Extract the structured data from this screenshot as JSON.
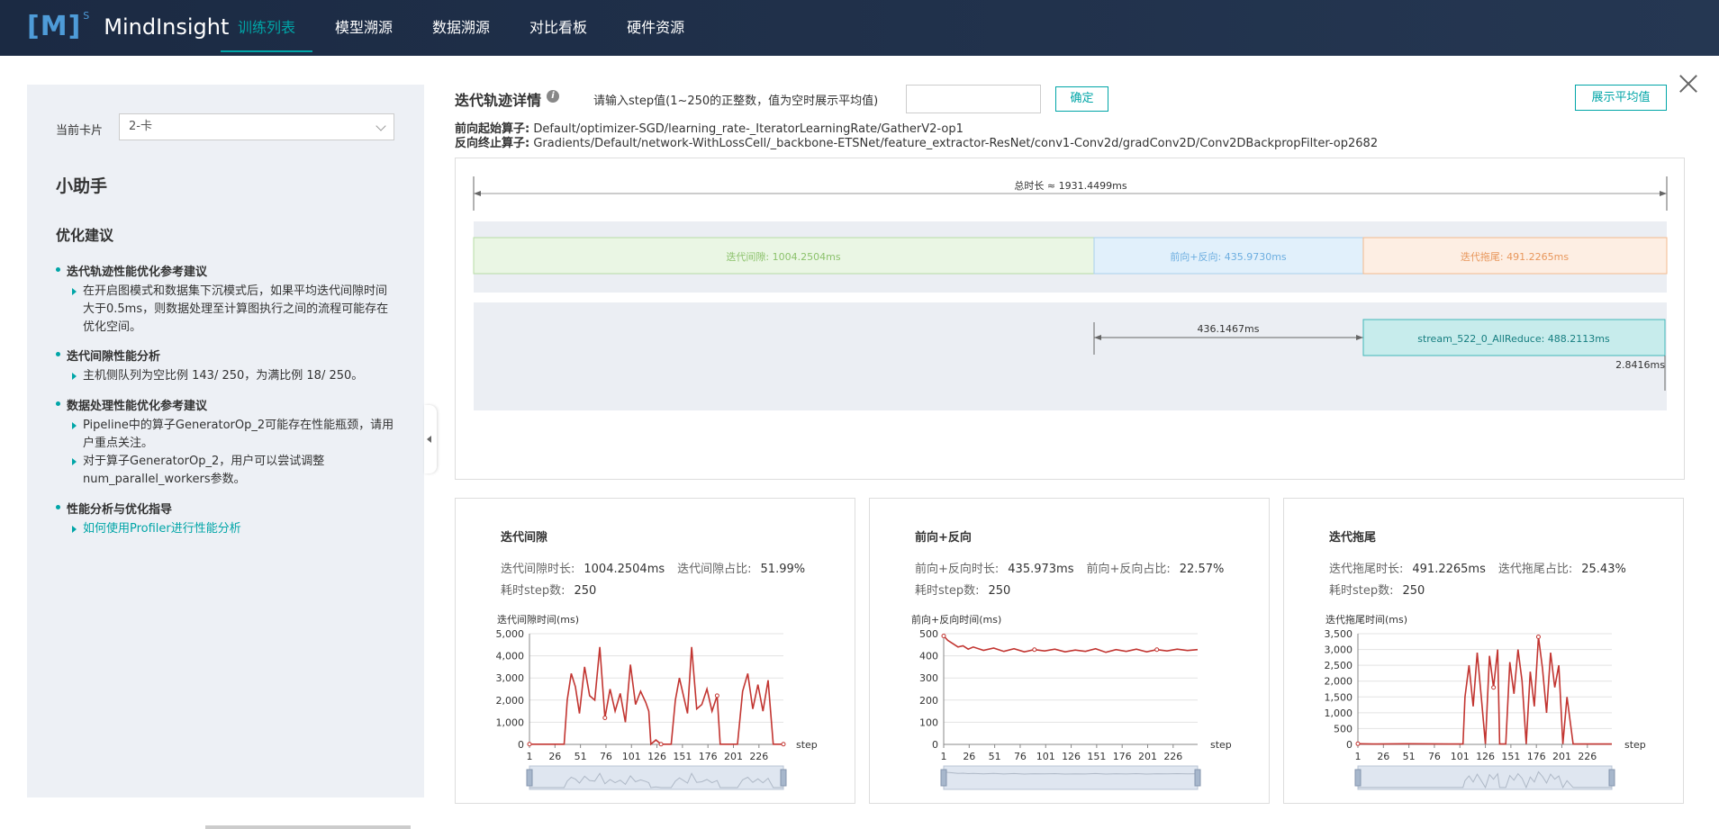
{
  "app": {
    "logo_mark": "[M]",
    "logo_sup": "S",
    "name": "MindInsight"
  },
  "nav": [
    {
      "label": "训练列表",
      "active": true
    },
    {
      "label": "模型溯源",
      "active": false
    },
    {
      "label": "数据溯源",
      "active": false
    },
    {
      "label": "对比看板",
      "active": false
    },
    {
      "label": "硬件资源",
      "active": false
    }
  ],
  "sidebar": {
    "card_label": "当前卡片",
    "card_value": "2-卡",
    "helper_title": "小助手",
    "opt_title": "优化建议",
    "sections": [
      {
        "title": "迭代轨迹性能优化参考建议",
        "items": [
          "在开启图模式和数据集下沉模式后，如果平均迭代间隙时间大于0.5ms，则数据处理至计算图执行之间的流程可能存在优化空间。"
        ]
      },
      {
        "title": "迭代间隙性能分析",
        "items": [
          "主机侧队列为空比例 143/ 250，为满比例 18/ 250。"
        ]
      },
      {
        "title": "数据处理性能优化参考建议",
        "items": [
          "Pipeline中的算子GeneratorOp_2可能存在性能瓶颈，请用户重点关注。",
          "对于算子GeneratorOp_2，用户可以尝试调整num_parallel_workers参数。"
        ]
      },
      {
        "title": "性能分析与优化指导",
        "items": [
          "如何使用Profiler进行性能分析"
        ]
      }
    ]
  },
  "main": {
    "title": "迭代轨迹详情",
    "step_label": "请输入step值(1~250的正整数，值为空时展示平均值)",
    "step_input": "",
    "ok_button": "确定",
    "avg_button": "展示平均值",
    "fp_start_label": "前向起始算子:",
    "fp_start_value": "Default/optimizer-SGD/learning_rate-_IteratorLearningRate/GatherV2-op1",
    "bp_end_label": "反向终止算子:",
    "bp_end_value": "Gradients/Default/network-WithLossCell/_backbone-ETSNet/feature_extractor-ResNet/conv1-Conv2d/gradConv2D/Conv2DBackpropFilter-op2682"
  },
  "timeline": {
    "total_label": "总时长 ≈ 1931.4499ms",
    "gap_label": "迭代间隙: 1004.2504ms",
    "fpbp_label": "前向+反向: 435.9730ms",
    "tail_label": "迭代拖尾: 491.2265ms",
    "interval_label": "436.1467ms",
    "stream_label": "stream_522_0_AllReduce: 488.2113ms",
    "tail_gap_label": "2.8416ms",
    "colors": {
      "gap": "#eaf6e4",
      "fpbp": "#e1f0fb",
      "tail": "#fdeee3",
      "stream": "#c7ecec"
    }
  },
  "panels": [
    {
      "title": "迭代间隙",
      "stat1_label": "迭代间隙时长:",
      "stat1_value": "1004.2504ms",
      "stat2_label": "迭代间隙占比:",
      "stat2_value": "51.99%",
      "stat3_label": "耗时step数:",
      "stat3_value": "250",
      "ylabel": "迭代间隙时间(ms)",
      "xlabel": "step"
    },
    {
      "title": "前向+反向",
      "stat1_label": "前向+反向时长:",
      "stat1_value": "435.973ms",
      "stat2_label": "前向+反向占比:",
      "stat2_value": "22.57%",
      "stat3_label": "耗时step数:",
      "stat3_value": "250",
      "ylabel": "前向+反向时间(ms)",
      "xlabel": "step"
    },
    {
      "title": "迭代拖尾",
      "stat1_label": "迭代拖尾时长:",
      "stat1_value": "491.2265ms",
      "stat2_label": "迭代拖尾占比:",
      "stat2_value": "25.43%",
      "stat3_label": "耗时step数:",
      "stat3_value": "250",
      "ylabel": "迭代拖尾时间(ms)",
      "xlabel": "step"
    }
  ],
  "chart_data": [
    {
      "type": "line",
      "ylabel": "迭代间隙时间(ms)",
      "xlabel": "step",
      "ylim": [
        0,
        5000
      ],
      "yticks": [
        "0",
        "1,000",
        "2,000",
        "3,000",
        "4,000",
        "5,000"
      ],
      "xticks": [
        "1",
        "26",
        "51",
        "76",
        "101",
        "126",
        "151",
        "176",
        "201",
        "226"
      ],
      "x": [
        1,
        10,
        20,
        35,
        38,
        42,
        46,
        50,
        55,
        60,
        65,
        70,
        75,
        80,
        85,
        90,
        95,
        100,
        105,
        110,
        115,
        118,
        120,
        125,
        130,
        135,
        140,
        144,
        148,
        152,
        156,
        160,
        165,
        170,
        175,
        180,
        185,
        188,
        195,
        200,
        205,
        210,
        215,
        220,
        225,
        230,
        235,
        240,
        250
      ],
      "values": [
        10,
        10,
        10,
        10,
        2000,
        3200,
        2600,
        1400,
        3500,
        2200,
        2000,
        4400,
        1200,
        2500,
        1500,
        2300,
        1000,
        3600,
        1800,
        2400,
        1900,
        1500,
        10,
        200,
        10,
        10,
        10,
        2000,
        3000,
        2200,
        1400,
        4400,
        1600,
        1800,
        2500,
        1500,
        2200,
        10,
        10,
        10,
        10,
        2400,
        3200,
        1600,
        2700,
        1500,
        2900,
        10,
        10
      ]
    },
    {
      "type": "line",
      "ylabel": "前向+反向时间(ms)",
      "xlabel": "step",
      "ylim": [
        0,
        500
      ],
      "yticks": [
        "0",
        "100",
        "200",
        "300",
        "400",
        "500"
      ],
      "xticks": [
        "1",
        "26",
        "51",
        "76",
        "101",
        "126",
        "151",
        "176",
        "201",
        "226"
      ],
      "x": [
        1,
        5,
        10,
        15,
        20,
        25,
        30,
        40,
        50,
        60,
        70,
        80,
        90,
        100,
        110,
        120,
        130,
        140,
        150,
        160,
        170,
        180,
        190,
        200,
        210,
        220,
        230,
        240,
        250
      ],
      "values": [
        490,
        470,
        455,
        440,
        445,
        430,
        440,
        425,
        435,
        420,
        432,
        418,
        428,
        422,
        430,
        418,
        426,
        420,
        432,
        416,
        428,
        420,
        430,
        418,
        428,
        422,
        430,
        424,
        428
      ]
    },
    {
      "type": "line",
      "ylabel": "迭代拖尾时间(ms)",
      "xlabel": "step",
      "ylim": [
        0,
        3500
      ],
      "yticks": [
        "0",
        "500",
        "1,000",
        "1,500",
        "2,000",
        "2,500",
        "3,000",
        "3,500"
      ],
      "xticks": [
        "1",
        "26",
        "51",
        "76",
        "101",
        "126",
        "151",
        "176",
        "201",
        "226"
      ],
      "x": [
        1,
        20,
        50,
        90,
        104,
        106,
        110,
        114,
        118,
        122,
        126,
        130,
        134,
        138,
        140,
        142,
        146,
        150,
        154,
        158,
        162,
        166,
        170,
        174,
        178,
        182,
        186,
        190,
        194,
        198,
        202,
        206,
        212,
        230,
        250
      ],
      "values": [
        20,
        10,
        20,
        10,
        10,
        1500,
        2500,
        1200,
        2900,
        1500,
        10,
        2800,
        1800,
        3000,
        10,
        10,
        10,
        2600,
        1600,
        3000,
        2000,
        10,
        2300,
        1200,
        3400,
        2400,
        1000,
        2900,
        1800,
        2500,
        10,
        1500,
        10,
        10,
        10
      ]
    }
  ]
}
